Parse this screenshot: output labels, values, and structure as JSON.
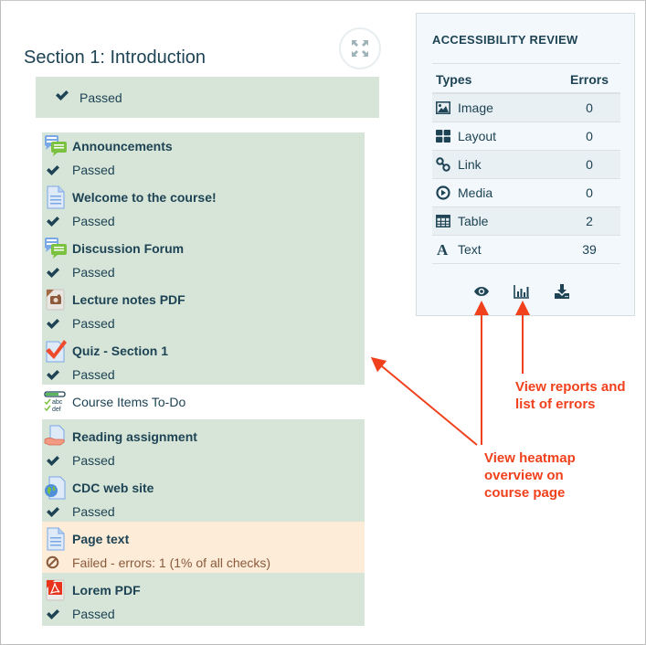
{
  "section": {
    "title": "Section 1: Introduction",
    "status": "Passed",
    "expand_icon": "expand-arrows-icon"
  },
  "items": [
    {
      "title": "Announcements",
      "icon": "forum-icon",
      "status": "passed",
      "status_text": "Passed"
    },
    {
      "title": "Welcome to the course!",
      "icon": "page-icon",
      "status": "passed",
      "status_text": "Passed"
    },
    {
      "title": "Discussion Forum",
      "icon": "forum-icon",
      "status": "passed",
      "status_text": "Passed"
    },
    {
      "title": "Lecture notes PDF",
      "icon": "image-file-icon",
      "status": "passed",
      "status_text": "Passed"
    },
    {
      "title": "Quiz - Section 1",
      "icon": "quiz-icon",
      "status": "passed",
      "status_text": "Passed"
    },
    {
      "title": "Course Items To-Do",
      "icon": "checklist-icon",
      "status": "none",
      "status_text": ""
    },
    {
      "title": "Reading assignment",
      "icon": "assignment-icon",
      "status": "passed",
      "status_text": "Passed"
    },
    {
      "title": "CDC web site",
      "icon": "url-icon",
      "status": "passed",
      "status_text": "Passed"
    },
    {
      "title": "Page text",
      "icon": "page-icon",
      "status": "failed",
      "status_text": "Failed - errors: 1 (1% of all checks)"
    },
    {
      "title": "Lorem PDF",
      "icon": "pdf-icon",
      "status": "passed",
      "status_text": "Passed"
    }
  ],
  "panel": {
    "title": "ACCESSIBILITY REVIEW",
    "col_types": "Types",
    "col_errors": "Errors",
    "rows": [
      {
        "type": "Image",
        "icon": "image-icon",
        "errors": "0"
      },
      {
        "type": "Layout",
        "icon": "layout-grid-icon",
        "errors": "0"
      },
      {
        "type": "Link",
        "icon": "link-icon",
        "errors": "0"
      },
      {
        "type": "Media",
        "icon": "play-circle-icon",
        "errors": "0"
      },
      {
        "type": "Table",
        "icon": "table-icon",
        "errors": "2"
      },
      {
        "type": "Text",
        "icon": "text-a-icon",
        "errors": "39"
      }
    ],
    "actions": [
      {
        "name": "view-heatmap",
        "icon": "eye-icon"
      },
      {
        "name": "view-reports",
        "icon": "bar-chart-icon"
      },
      {
        "name": "download-report",
        "icon": "download-icon"
      }
    ]
  },
  "annotations": {
    "reports": [
      "View reports and",
      "list of errors"
    ],
    "heatmap": [
      "View heatmap",
      "overview on",
      "course page"
    ]
  },
  "colors": {
    "passed_bg": "#d7e5d8",
    "failed_bg": "#fdecd8",
    "text": "#1d4354",
    "annotation": "#f0401c"
  }
}
